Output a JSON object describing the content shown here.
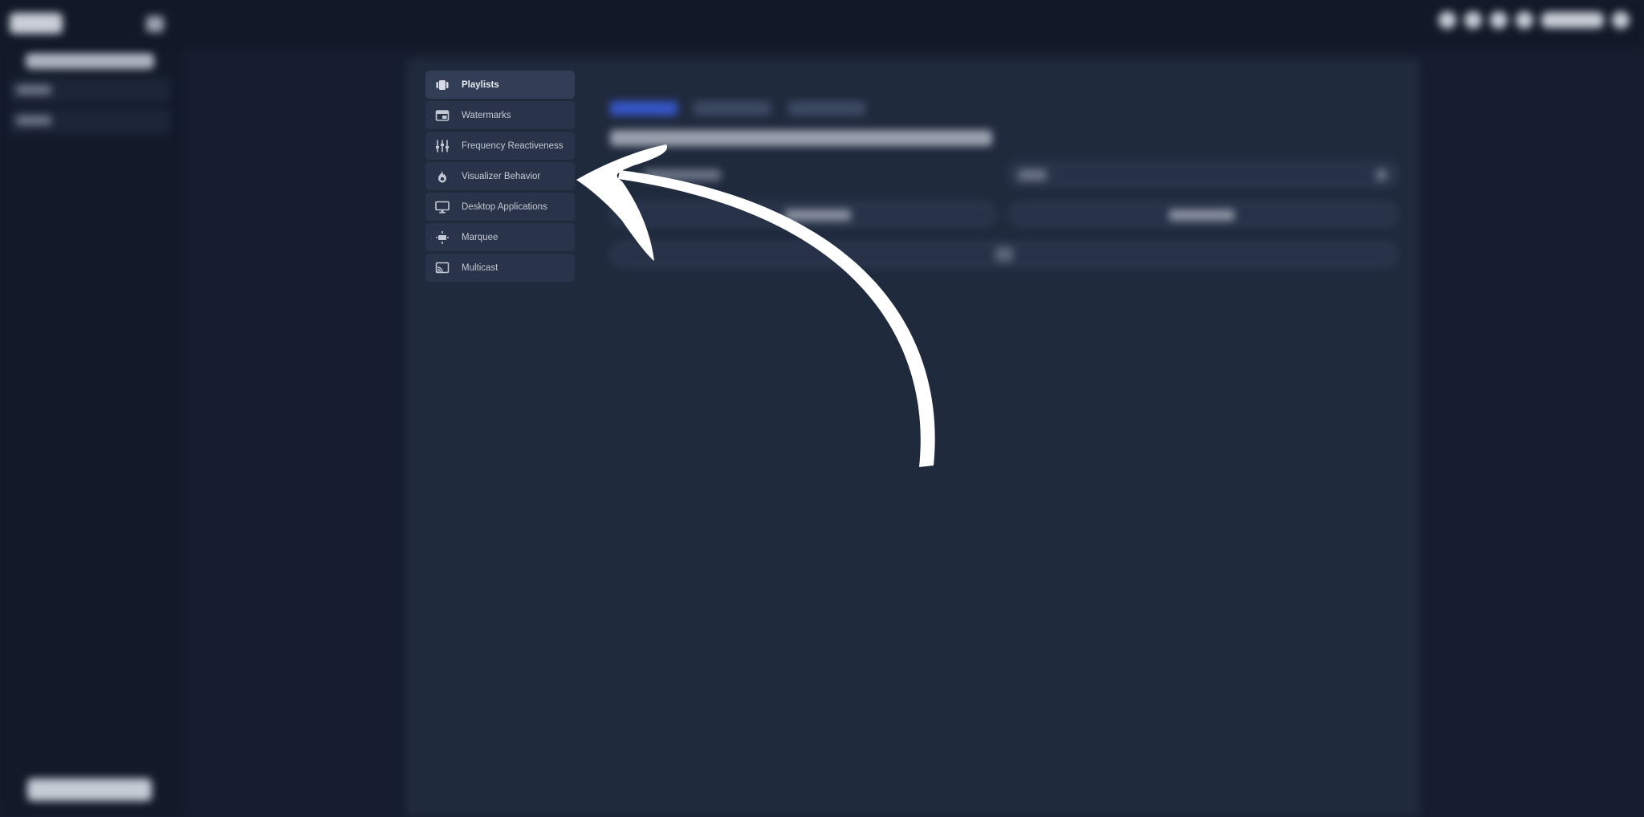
{
  "menu": {
    "items": [
      {
        "label": "Playlists",
        "icon": "playlist-icon",
        "active": true
      },
      {
        "label": "Watermarks",
        "icon": "watermark-icon",
        "active": false
      },
      {
        "label": "Frequency Reactiveness",
        "icon": "equalizer-icon",
        "active": false
      },
      {
        "label": "Visualizer Behavior",
        "icon": "flame-icon",
        "active": false
      },
      {
        "label": "Desktop Applications",
        "icon": "monitor-icon",
        "active": false
      },
      {
        "label": "Marquee",
        "icon": "marquee-icon",
        "active": false
      },
      {
        "label": "Multicast",
        "icon": "cast-icon",
        "active": false
      }
    ]
  },
  "colors": {
    "background": "#151d2e",
    "panel": "#202a3d",
    "menu_item": "#29344a",
    "menu_item_active": "#323e56",
    "menu_text": "#c3c9d4",
    "arrow": "#ffffff",
    "tab_active": "#3556c8"
  }
}
